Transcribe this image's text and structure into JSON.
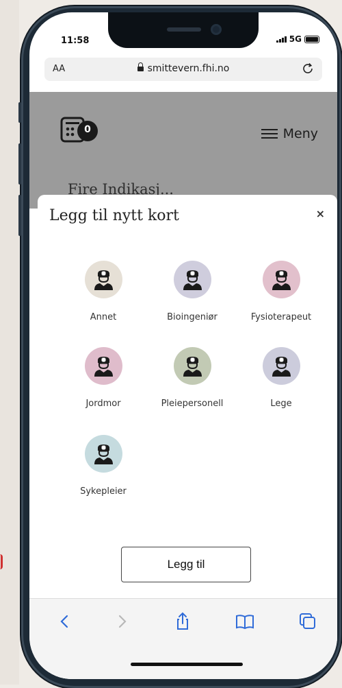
{
  "status_bar": {
    "time": "11:58",
    "network": "5G"
  },
  "browser": {
    "text_size_label": "AA",
    "url": "smittevern.fhi.no"
  },
  "site_header": {
    "card_count": "0",
    "menu_label": "Meny"
  },
  "page_peek_text": "Fire Indikasj...",
  "dialog": {
    "title": "Legg til nytt kort",
    "close_label": "×",
    "professions": [
      {
        "label": "Annet",
        "color": "#e6e0d6"
      },
      {
        "label": "Bioingeniør",
        "color": "#cfcddd"
      },
      {
        "label": "Fysioterapeut",
        "color": "#e2c0cc"
      },
      {
        "label": "Jordmor",
        "color": "#dfbccb"
      },
      {
        "label": "Pleiepersonell",
        "color": "#c2cab4"
      },
      {
        "label": "Lege",
        "color": "#ccccdc"
      },
      {
        "label": "Sykepleier",
        "color": "#c5dbdf"
      }
    ],
    "add_button_label": "Legg til"
  },
  "toolbar_icons": [
    "back-icon",
    "forward-icon",
    "share-icon",
    "bookmarks-icon",
    "tabs-icon"
  ]
}
